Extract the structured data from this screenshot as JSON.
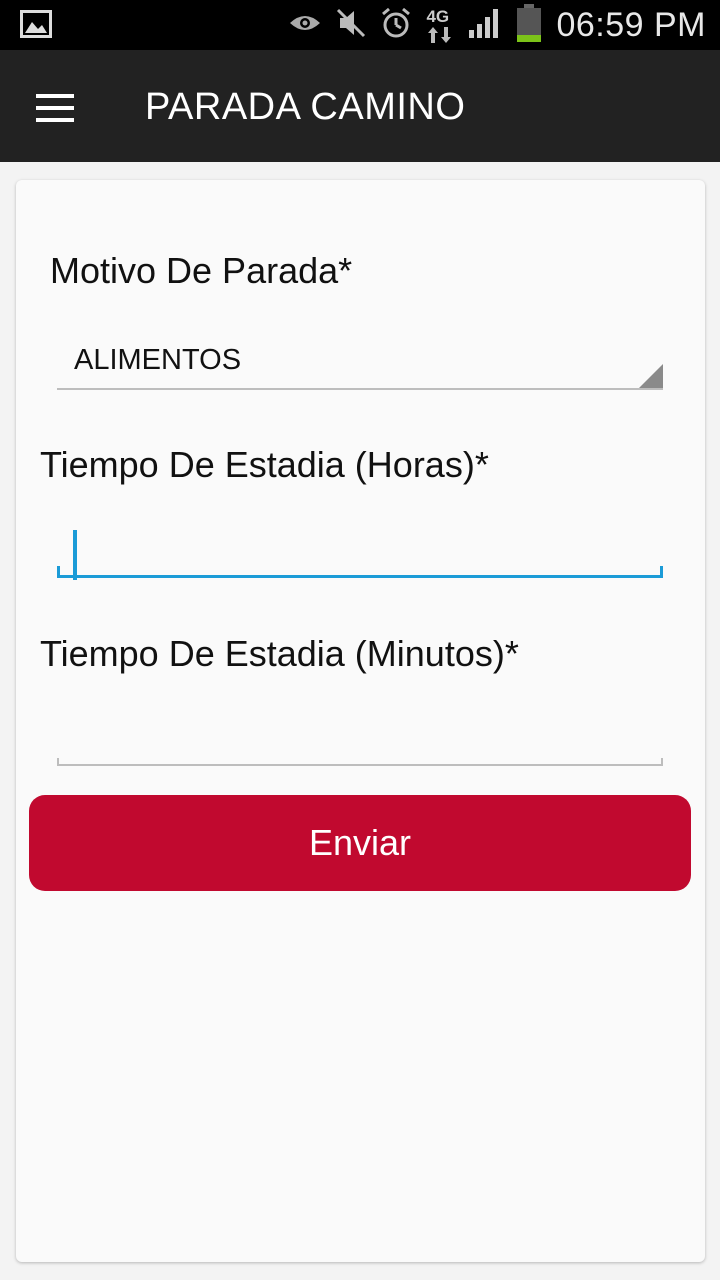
{
  "status_bar": {
    "time": "06:59 PM",
    "network": "4G",
    "icons": [
      "image-icon",
      "eye-icon",
      "mute-icon",
      "alarm-icon",
      "network-4g-icon",
      "signal-icon",
      "battery-icon"
    ]
  },
  "toolbar": {
    "title": "PARADA CAMINO",
    "menu_icon": "hamburger-menu-icon"
  },
  "form": {
    "motivo_label": "Motivo De Parada*",
    "motivo_value": "ALIMENTOS",
    "horas_label": "Tiempo De Estadia (Horas)*",
    "horas_value": "",
    "minutos_label": "Tiempo De Estadia (Minutos)*",
    "minutos_value": "",
    "submit_label": "Enviar"
  },
  "colors": {
    "accent": "#1b9bd7",
    "submit": "#c1092f",
    "toolbar": "#222222",
    "battery_level": "#7cc319"
  }
}
